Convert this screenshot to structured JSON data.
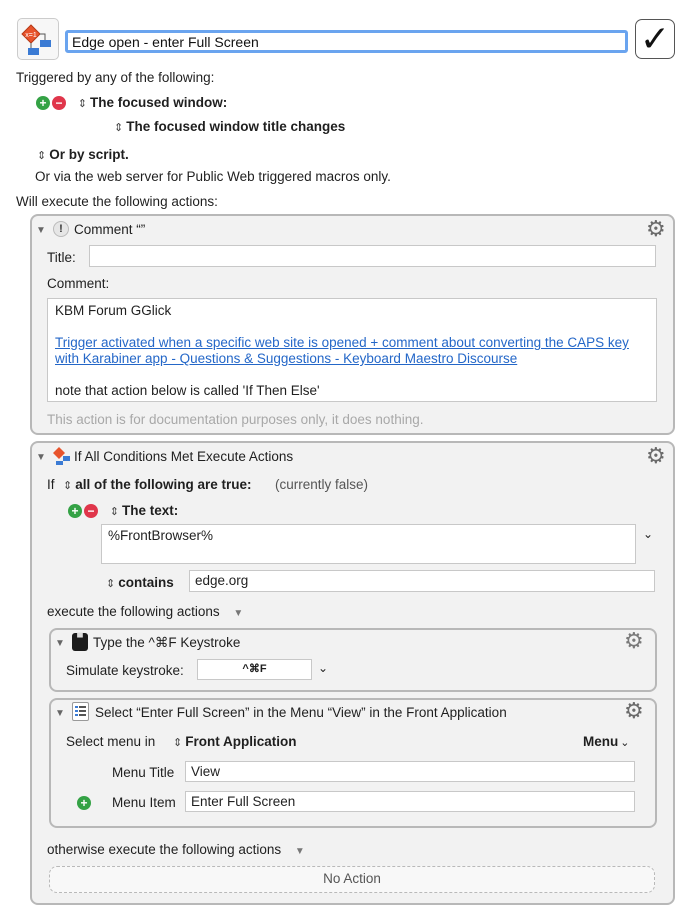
{
  "macro": {
    "name": "Edge open - enter Full Screen",
    "enabled_checkmark": "✓"
  },
  "triggers": {
    "intro": "Triggered by any of the following:",
    "focused_window_label": "The focused window:",
    "focused_window_condition": "The focused window title changes",
    "or_by_script": "Or by script.",
    "web_server_note": "Or via the web server for Public Web triggered macros only."
  },
  "actions_intro": "Will execute the following actions:",
  "comment_action": {
    "header": "Comment “”",
    "title_label": "Title:",
    "title_value": "",
    "comment_label": "Comment:",
    "line1": "KBM Forum GGlick",
    "link_text": "Trigger activated when a specific web site is opened + comment about converting the CAPS key with Karabiner app - Questions & Suggestions - Keyboard Maestro Discourse",
    "line3": "note that action below is called 'If Then Else'",
    "footer": "This action is for documentation purposes only, it does nothing."
  },
  "if_action": {
    "header": "If All Conditions Met Execute Actions",
    "if_label": "If",
    "all_true": "all of the following are true:",
    "status": "(currently false)",
    "the_text_label": "The text:",
    "text_value": "%FrontBrowser%",
    "contains_label": "contains",
    "contains_value": "edge.org",
    "execute_label": "execute the following actions",
    "otherwise_label": "otherwise execute the following actions",
    "no_action": "No Action"
  },
  "keystroke_action": {
    "header": "Type the ^⌘F Keystroke",
    "simulate_label": "Simulate keystroke:",
    "keystroke": "^⌘F"
  },
  "menu_action": {
    "header": "Select “Enter Full Screen” in the Menu “View” in the Front Application",
    "select_menu_label": "Select menu in",
    "application": "Front Application",
    "menu_dropdown": "Menu",
    "menu_title_label": "Menu Title",
    "menu_title_value": "View",
    "menu_item_label": "Menu Item",
    "menu_item_value": "Enter Full Screen"
  },
  "colors": {
    "panel_bg": "#f2f2f2",
    "panel_border": "#b8b8b8",
    "link": "#2467c8",
    "plus": "#34a245",
    "minus": "#e0364b",
    "focus_ring": "#6aa4ef"
  }
}
